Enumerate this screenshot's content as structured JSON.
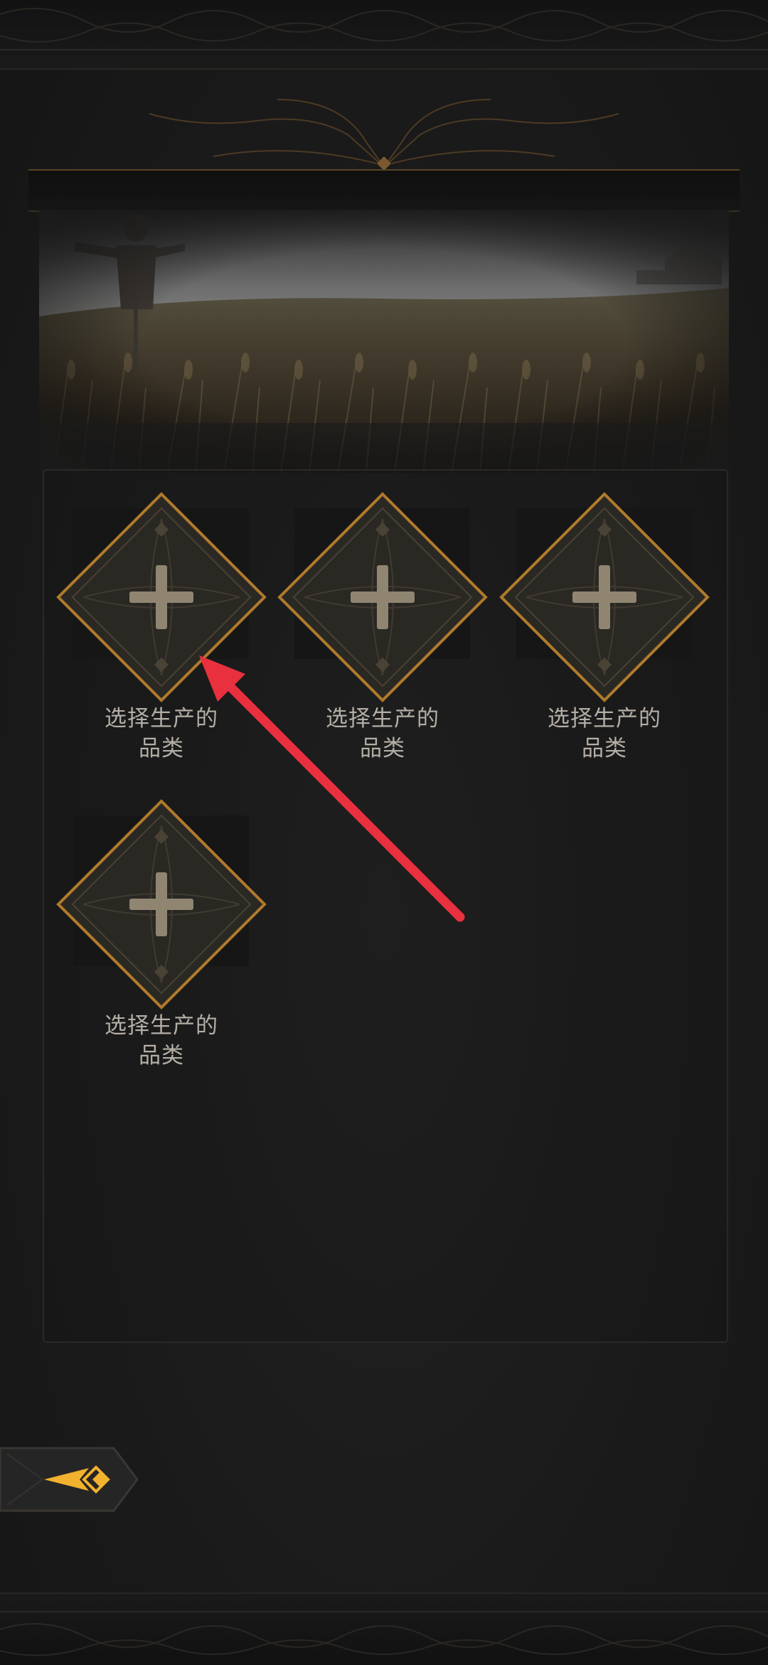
{
  "screen": {
    "background": "#1b1b1b",
    "accent_color": "#e0a032"
  },
  "banner": {
    "icon": "scarecrow-wheat-field-image"
  },
  "slots": [
    {
      "line1": "选择生产的",
      "line2": "品类",
      "icon": "plus-icon"
    },
    {
      "line1": "选择生产的",
      "line2": "品类",
      "icon": "plus-icon"
    },
    {
      "line1": "选择生产的",
      "line2": "品类",
      "icon": "plus-icon"
    },
    {
      "line1": "选择生产的",
      "line2": "品类",
      "icon": "plus-icon"
    }
  ],
  "back_button": {
    "icon": "back-arrow-icon"
  },
  "annotation": {
    "color": "#e8303f"
  }
}
